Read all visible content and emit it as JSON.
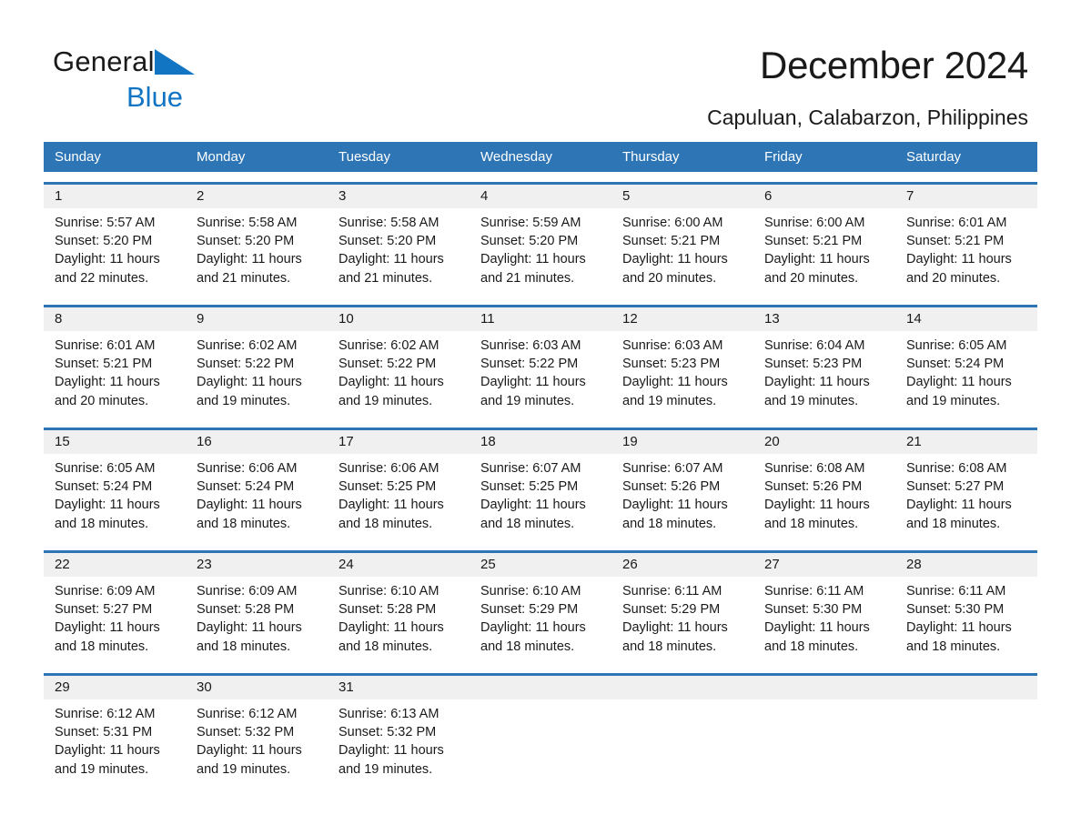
{
  "brand": {
    "name_part1": "General",
    "name_part2": "Blue",
    "logo_icon": "triangle-flag-icon",
    "accent_color": "#1275c4"
  },
  "header": {
    "title": "December 2024",
    "location": "Capuluan, Calabarzon, Philippines"
  },
  "theme": {
    "header_row_color": "#2e75b6",
    "date_bar_color": "#f0f0f0",
    "text_color": "#1a1a1a"
  },
  "weekdays": [
    "Sunday",
    "Monday",
    "Tuesday",
    "Wednesday",
    "Thursday",
    "Friday",
    "Saturday"
  ],
  "weeks": [
    {
      "days": [
        {
          "date": "1",
          "sunrise": "Sunrise: 5:57 AM",
          "sunset": "Sunset: 5:20 PM",
          "daylight1": "Daylight: 11 hours",
          "daylight2": "and 22 minutes."
        },
        {
          "date": "2",
          "sunrise": "Sunrise: 5:58 AM",
          "sunset": "Sunset: 5:20 PM",
          "daylight1": "Daylight: 11 hours",
          "daylight2": "and 21 minutes."
        },
        {
          "date": "3",
          "sunrise": "Sunrise: 5:58 AM",
          "sunset": "Sunset: 5:20 PM",
          "daylight1": "Daylight: 11 hours",
          "daylight2": "and 21 minutes."
        },
        {
          "date": "4",
          "sunrise": "Sunrise: 5:59 AM",
          "sunset": "Sunset: 5:20 PM",
          "daylight1": "Daylight: 11 hours",
          "daylight2": "and 21 minutes."
        },
        {
          "date": "5",
          "sunrise": "Sunrise: 6:00 AM",
          "sunset": "Sunset: 5:21 PM",
          "daylight1": "Daylight: 11 hours",
          "daylight2": "and 20 minutes."
        },
        {
          "date": "6",
          "sunrise": "Sunrise: 6:00 AM",
          "sunset": "Sunset: 5:21 PM",
          "daylight1": "Daylight: 11 hours",
          "daylight2": "and 20 minutes."
        },
        {
          "date": "7",
          "sunrise": "Sunrise: 6:01 AM",
          "sunset": "Sunset: 5:21 PM",
          "daylight1": "Daylight: 11 hours",
          "daylight2": "and 20 minutes."
        }
      ]
    },
    {
      "days": [
        {
          "date": "8",
          "sunrise": "Sunrise: 6:01 AM",
          "sunset": "Sunset: 5:21 PM",
          "daylight1": "Daylight: 11 hours",
          "daylight2": "and 20 minutes."
        },
        {
          "date": "9",
          "sunrise": "Sunrise: 6:02 AM",
          "sunset": "Sunset: 5:22 PM",
          "daylight1": "Daylight: 11 hours",
          "daylight2": "and 19 minutes."
        },
        {
          "date": "10",
          "sunrise": "Sunrise: 6:02 AM",
          "sunset": "Sunset: 5:22 PM",
          "daylight1": "Daylight: 11 hours",
          "daylight2": "and 19 minutes."
        },
        {
          "date": "11",
          "sunrise": "Sunrise: 6:03 AM",
          "sunset": "Sunset: 5:22 PM",
          "daylight1": "Daylight: 11 hours",
          "daylight2": "and 19 minutes."
        },
        {
          "date": "12",
          "sunrise": "Sunrise: 6:03 AM",
          "sunset": "Sunset: 5:23 PM",
          "daylight1": "Daylight: 11 hours",
          "daylight2": "and 19 minutes."
        },
        {
          "date": "13",
          "sunrise": "Sunrise: 6:04 AM",
          "sunset": "Sunset: 5:23 PM",
          "daylight1": "Daylight: 11 hours",
          "daylight2": "and 19 minutes."
        },
        {
          "date": "14",
          "sunrise": "Sunrise: 6:05 AM",
          "sunset": "Sunset: 5:24 PM",
          "daylight1": "Daylight: 11 hours",
          "daylight2": "and 19 minutes."
        }
      ]
    },
    {
      "days": [
        {
          "date": "15",
          "sunrise": "Sunrise: 6:05 AM",
          "sunset": "Sunset: 5:24 PM",
          "daylight1": "Daylight: 11 hours",
          "daylight2": "and 18 minutes."
        },
        {
          "date": "16",
          "sunrise": "Sunrise: 6:06 AM",
          "sunset": "Sunset: 5:24 PM",
          "daylight1": "Daylight: 11 hours",
          "daylight2": "and 18 minutes."
        },
        {
          "date": "17",
          "sunrise": "Sunrise: 6:06 AM",
          "sunset": "Sunset: 5:25 PM",
          "daylight1": "Daylight: 11 hours",
          "daylight2": "and 18 minutes."
        },
        {
          "date": "18",
          "sunrise": "Sunrise: 6:07 AM",
          "sunset": "Sunset: 5:25 PM",
          "daylight1": "Daylight: 11 hours",
          "daylight2": "and 18 minutes."
        },
        {
          "date": "19",
          "sunrise": "Sunrise: 6:07 AM",
          "sunset": "Sunset: 5:26 PM",
          "daylight1": "Daylight: 11 hours",
          "daylight2": "and 18 minutes."
        },
        {
          "date": "20",
          "sunrise": "Sunrise: 6:08 AM",
          "sunset": "Sunset: 5:26 PM",
          "daylight1": "Daylight: 11 hours",
          "daylight2": "and 18 minutes."
        },
        {
          "date": "21",
          "sunrise": "Sunrise: 6:08 AM",
          "sunset": "Sunset: 5:27 PM",
          "daylight1": "Daylight: 11 hours",
          "daylight2": "and 18 minutes."
        }
      ]
    },
    {
      "days": [
        {
          "date": "22",
          "sunrise": "Sunrise: 6:09 AM",
          "sunset": "Sunset: 5:27 PM",
          "daylight1": "Daylight: 11 hours",
          "daylight2": "and 18 minutes."
        },
        {
          "date": "23",
          "sunrise": "Sunrise: 6:09 AM",
          "sunset": "Sunset: 5:28 PM",
          "daylight1": "Daylight: 11 hours",
          "daylight2": "and 18 minutes."
        },
        {
          "date": "24",
          "sunrise": "Sunrise: 6:10 AM",
          "sunset": "Sunset: 5:28 PM",
          "daylight1": "Daylight: 11 hours",
          "daylight2": "and 18 minutes."
        },
        {
          "date": "25",
          "sunrise": "Sunrise: 6:10 AM",
          "sunset": "Sunset: 5:29 PM",
          "daylight1": "Daylight: 11 hours",
          "daylight2": "and 18 minutes."
        },
        {
          "date": "26",
          "sunrise": "Sunrise: 6:11 AM",
          "sunset": "Sunset: 5:29 PM",
          "daylight1": "Daylight: 11 hours",
          "daylight2": "and 18 minutes."
        },
        {
          "date": "27",
          "sunrise": "Sunrise: 6:11 AM",
          "sunset": "Sunset: 5:30 PM",
          "daylight1": "Daylight: 11 hours",
          "daylight2": "and 18 minutes."
        },
        {
          "date": "28",
          "sunrise": "Sunrise: 6:11 AM",
          "sunset": "Sunset: 5:30 PM",
          "daylight1": "Daylight: 11 hours",
          "daylight2": "and 18 minutes."
        }
      ]
    },
    {
      "days": [
        {
          "date": "29",
          "sunrise": "Sunrise: 6:12 AM",
          "sunset": "Sunset: 5:31 PM",
          "daylight1": "Daylight: 11 hours",
          "daylight2": "and 19 minutes."
        },
        {
          "date": "30",
          "sunrise": "Sunrise: 6:12 AM",
          "sunset": "Sunset: 5:32 PM",
          "daylight1": "Daylight: 11 hours",
          "daylight2": "and 19 minutes."
        },
        {
          "date": "31",
          "sunrise": "Sunrise: 6:13 AM",
          "sunset": "Sunset: 5:32 PM",
          "daylight1": "Daylight: 11 hours",
          "daylight2": "and 19 minutes."
        },
        {
          "date": "",
          "sunrise": "",
          "sunset": "",
          "daylight1": "",
          "daylight2": ""
        },
        {
          "date": "",
          "sunrise": "",
          "sunset": "",
          "daylight1": "",
          "daylight2": ""
        },
        {
          "date": "",
          "sunrise": "",
          "sunset": "",
          "daylight1": "",
          "daylight2": ""
        },
        {
          "date": "",
          "sunrise": "",
          "sunset": "",
          "daylight1": "",
          "daylight2": ""
        }
      ]
    }
  ]
}
